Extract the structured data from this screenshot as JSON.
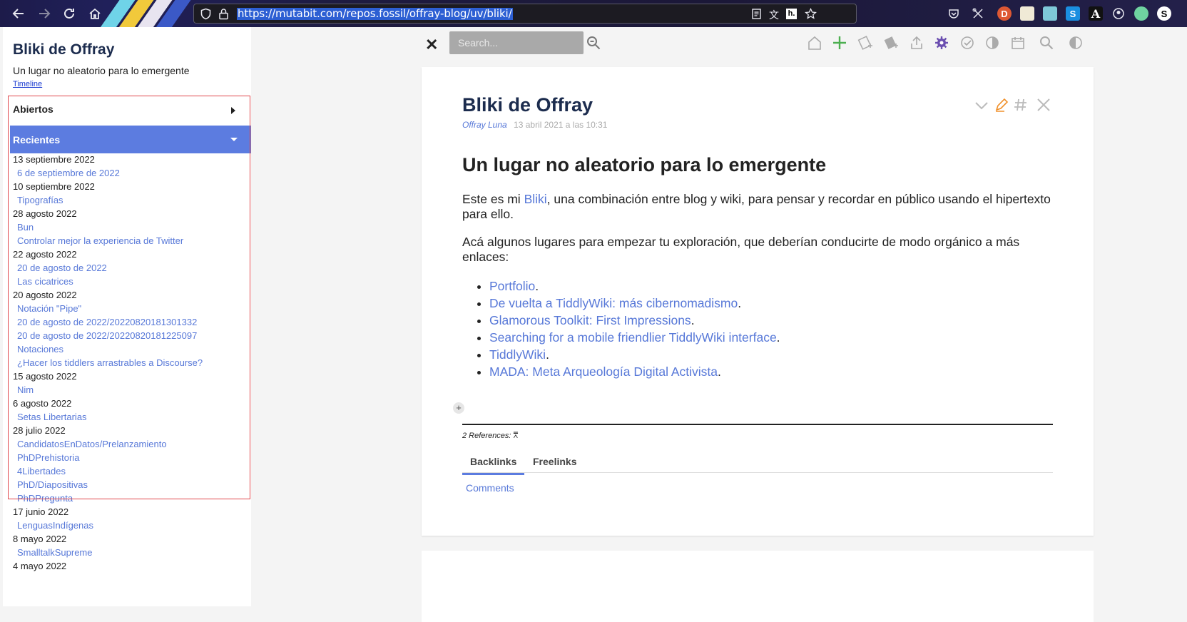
{
  "browser": {
    "url": "https://mutabit.com/repos.fossil/offray-blog/uv/bliki/"
  },
  "sidebar": {
    "site_title": "Bliki de Offray",
    "site_subtitle": "Un lugar no aleatorio para lo emergente",
    "timeline_link": "Timeline",
    "tabs": {
      "open": "Abiertos",
      "recent": "Recientes"
    },
    "recent_groups": [
      {
        "date": "13 septiembre 2022",
        "entries": [
          "6 de septiembre de 2022"
        ]
      },
      {
        "date": "10 septiembre 2022",
        "entries": [
          "Tipografías"
        ]
      },
      {
        "date": "28 agosto 2022",
        "entries": [
          "Bun",
          "Controlar mejor la experiencia de Twitter"
        ]
      },
      {
        "date": "22 agosto 2022",
        "entries": [
          "20 de agosto de 2022",
          "Las cicatrices"
        ]
      },
      {
        "date": "20 agosto 2022",
        "entries": [
          "Notación \"Pipe\"",
          "20 de agosto de 2022/20220820181301332",
          "20 de agosto de 2022/20220820181225097",
          "Notaciones",
          "¿Hacer los tiddlers arrastrables a Discourse?"
        ]
      },
      {
        "date": "15 agosto 2022",
        "entries": [
          "Nim"
        ]
      },
      {
        "date": "6 agosto 2022",
        "entries": [
          "Setas Libertarias"
        ]
      },
      {
        "date": "28 julio 2022",
        "entries": [
          "CandidatosEnDatos/Prelanzamiento",
          "PhDPrehistoria",
          "4Libertades",
          "PhD/Diapositivas",
          "PhDPregunta"
        ]
      },
      {
        "date": "17 junio 2022",
        "entries": [
          "LenguasIndígenas"
        ]
      },
      {
        "date": "8 mayo 2022",
        "entries": [
          "SmalltalkSupreme"
        ]
      },
      {
        "date": "4 mayo 2022",
        "entries": []
      }
    ]
  },
  "toolbar": {
    "search_placeholder": "Search..."
  },
  "tiddler": {
    "title": "Bliki de Offray",
    "author": "Offray Luna",
    "date": "13 abril 2021 a las 10:31",
    "heading": "Un lugar no aleatorio para lo emergente",
    "para1_prefix": "Este es mi ",
    "para1_link": "Bliki",
    "para1_suffix": ", una combinación entre blog y wiki, para pensar y recordar en público usando el hipertexto para ello.",
    "para2": "Acá algunos lugares para empezar tu exploración, que deberían conducirte de modo orgánico a más enlaces:",
    "links": [
      "Portfolio",
      "De vuelta a TiddlyWiki: más cibernomadismo",
      "Glamorous Toolkit: First Impressions",
      "Searching for a mobile friendlier TiddlyWiki interface",
      "TiddlyWiki",
      "MADA: Meta Arqueología Digital Activista"
    ],
    "references_label": "2 References:",
    "ref_tabs": [
      "Backlinks",
      "Freelinks"
    ],
    "comments_link": "Comments"
  },
  "colors": {
    "accent": "#5c7ce0",
    "link": "#5778d8",
    "title": "#1c2c4e",
    "highlight_box": "#e0474c"
  }
}
